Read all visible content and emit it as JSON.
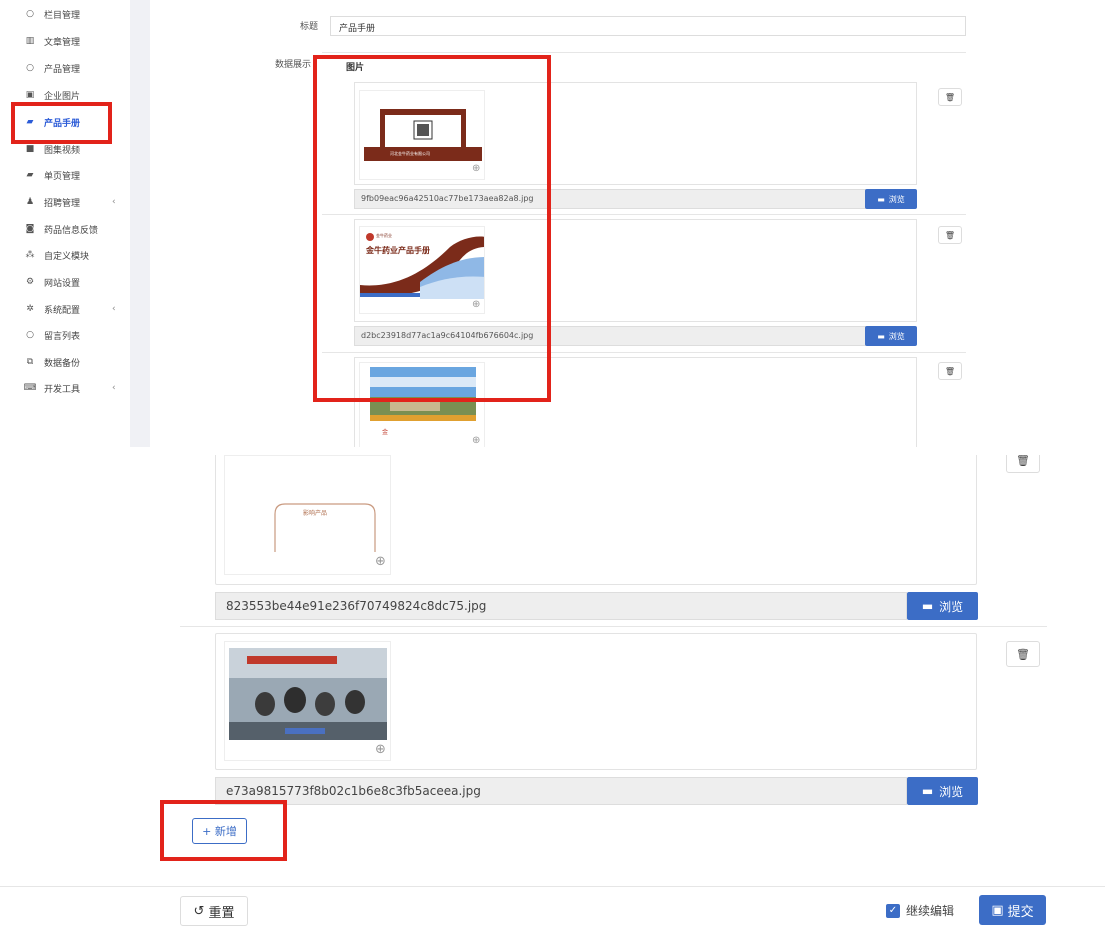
{
  "sidebar": {
    "items": [
      {
        "label": "栏目管理",
        "icon": "circle-icon"
      },
      {
        "label": "文章管理",
        "icon": "bar-chart-icon"
      },
      {
        "label": "产品管理",
        "icon": "circle-icon"
      },
      {
        "label": "企业图片",
        "icon": "image-icon"
      },
      {
        "label": "产品手册",
        "icon": "book-icon",
        "active": true
      },
      {
        "label": "图集视频",
        "icon": "video-icon"
      },
      {
        "label": "单页管理",
        "icon": "book-icon"
      },
      {
        "label": "招聘管理",
        "icon": "user-icon",
        "has_submenu": true
      },
      {
        "label": "药品信息反馈",
        "icon": "camera-icon"
      },
      {
        "label": "自定义模块",
        "icon": "cubes-icon"
      },
      {
        "label": "网站设置",
        "icon": "cogs-icon"
      },
      {
        "label": "系统配置",
        "icon": "gear-icon",
        "has_submenu": true
      },
      {
        "label": "留言列表",
        "icon": "circle-icon"
      },
      {
        "label": "数据备份",
        "icon": "copy-icon"
      },
      {
        "label": "开发工具",
        "icon": "keyboard-icon",
        "has_submenu": true
      }
    ],
    "active_color": "#2b5bd7"
  },
  "form": {
    "title_label": "标题",
    "title_value": "产品手册",
    "data_label": "数据展示",
    "images_header": "图片"
  },
  "top_images": [
    {
      "filename": "9fb09eac96a42510ac77be173aea82a8.jpg",
      "thumb_caption": "河北金牛药业有限公司"
    },
    {
      "filename": "d2bc23918d77ac1a9c64104fb676604c.jpg",
      "thumb_title": "金牛药业产品手册",
      "thumb_subtitle": "金牛药业"
    },
    {
      "filename": "",
      "thumb_caption": "金"
    }
  ],
  "bottom_images": [
    {
      "filename": "823553be44e91e236f70749824c8dc75.jpg",
      "thumb_caption": "影响产品"
    },
    {
      "filename": "e73a9815773f8b02c1b6e8c3fb5aceea.jpg"
    }
  ],
  "buttons": {
    "browse": "浏览",
    "delete": "🗑",
    "add": "+ 新增",
    "reset": "重置",
    "continue_edit": "继续编辑",
    "submit": "提交"
  },
  "icons": {
    "browse": "folder-open-icon",
    "zoom": "zoom-in-icon",
    "reset": "undo-icon",
    "submit": "save-icon",
    "delete": "trash-icon"
  },
  "colors": {
    "primary": "#3c6dc6",
    "highlight": "#e2231a"
  }
}
